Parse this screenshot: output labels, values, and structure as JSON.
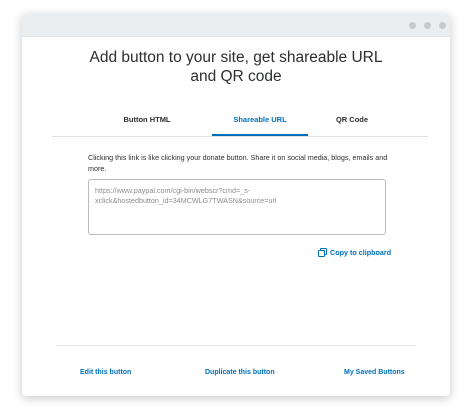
{
  "dialog": {
    "heading": "Add button to your site, get shareable URL\nand QR code"
  },
  "tabs": [
    {
      "label": "Button HTML",
      "active": false
    },
    {
      "label": "Shareable URL",
      "active": true
    },
    {
      "label": "QR Code",
      "active": false
    }
  ],
  "shareable_url": {
    "description": "Clicking this link is like clicking your donate button. Share it on social media, blogs, emails and more.",
    "url_value": "https://www.paypal.com/cgi-bin/webscr?cmd=_s-xclick&hostedbutton_id=34MCWLG7TWASN&source=url",
    "copy_label": "Copy to clipboard",
    "copy_icon": "copy-icon"
  },
  "footer": {
    "edit_label": "Edit this button",
    "duplicate_label": "Duplicate this button",
    "saved_label": "My Saved Buttons"
  },
  "colors": {
    "accent": "#0070ba",
    "text": "#2c2e2f",
    "titlebar": "#ebeef1"
  }
}
